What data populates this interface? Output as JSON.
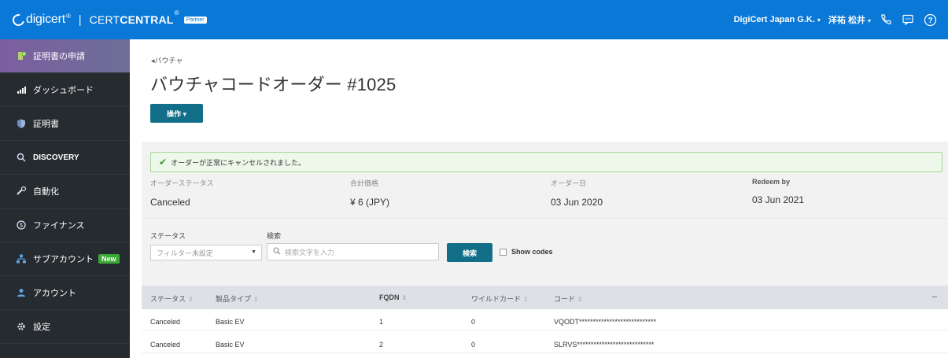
{
  "topbar": {
    "logo_text": "digicert",
    "logo_reg": "®",
    "separator": "|",
    "product_light": "CERT",
    "product_bold": "CENTRAL",
    "product_reg": "®",
    "partner_badge": "Partner",
    "account": "DigiCert Japan G.K.",
    "user": "洋祐 松井",
    "caret": "▾"
  },
  "sidebar": {
    "items": [
      {
        "label": "証明書の申請",
        "icon": "certificate-request-icon"
      },
      {
        "label": "ダッシュボード",
        "icon": "dashboard-icon"
      },
      {
        "label": "証明書",
        "icon": "shield-icon"
      },
      {
        "label": "DISCOVERY",
        "icon": "search-icon"
      },
      {
        "label": "自動化",
        "icon": "automation-icon"
      },
      {
        "label": "ファイナンス",
        "icon": "finance-icon"
      },
      {
        "label": "サブアカウント",
        "icon": "subaccount-icon",
        "badge": "New"
      },
      {
        "label": "アカウント",
        "icon": "user-icon"
      },
      {
        "label": "設定",
        "icon": "gear-icon"
      }
    ]
  },
  "main": {
    "breadcrumb": "◂バウチャ",
    "title": "バウチャコードオーダー #1025",
    "ops_button": "操作 ▾",
    "alert": "オーダーが正常にキャンセルされました。",
    "summary": [
      {
        "label": "オーダーステータス",
        "value": "Canceled"
      },
      {
        "label": "合計価格",
        "value": "¥ 6 (JPY)"
      },
      {
        "label": "オーダー日",
        "value": "03 Jun 2020"
      },
      {
        "label": "Redeem by",
        "value": "03 Jun 2021"
      }
    ],
    "filter": {
      "status_label": "ステータス",
      "status_value": "フィルター未設定",
      "search_label": "検索",
      "search_placeholder": "検索文字を入力",
      "search_button": "検索",
      "show_codes": "Show codes"
    },
    "table": {
      "headers": [
        "ステータス",
        "製品タイプ",
        "FQDN",
        "ワイルドカード",
        "コード"
      ],
      "collapse": "–",
      "rows": [
        [
          "Canceled",
          "Basic EV",
          "1",
          "0",
          "VQODT****************************"
        ],
        [
          "Canceled",
          "Basic EV",
          "2",
          "0",
          "SLRVS****************************"
        ]
      ]
    }
  },
  "colors": {
    "topbar": "#0a78d6",
    "sidebar": "#262b2f",
    "button": "#136f89",
    "success": "#3c9b2c"
  }
}
